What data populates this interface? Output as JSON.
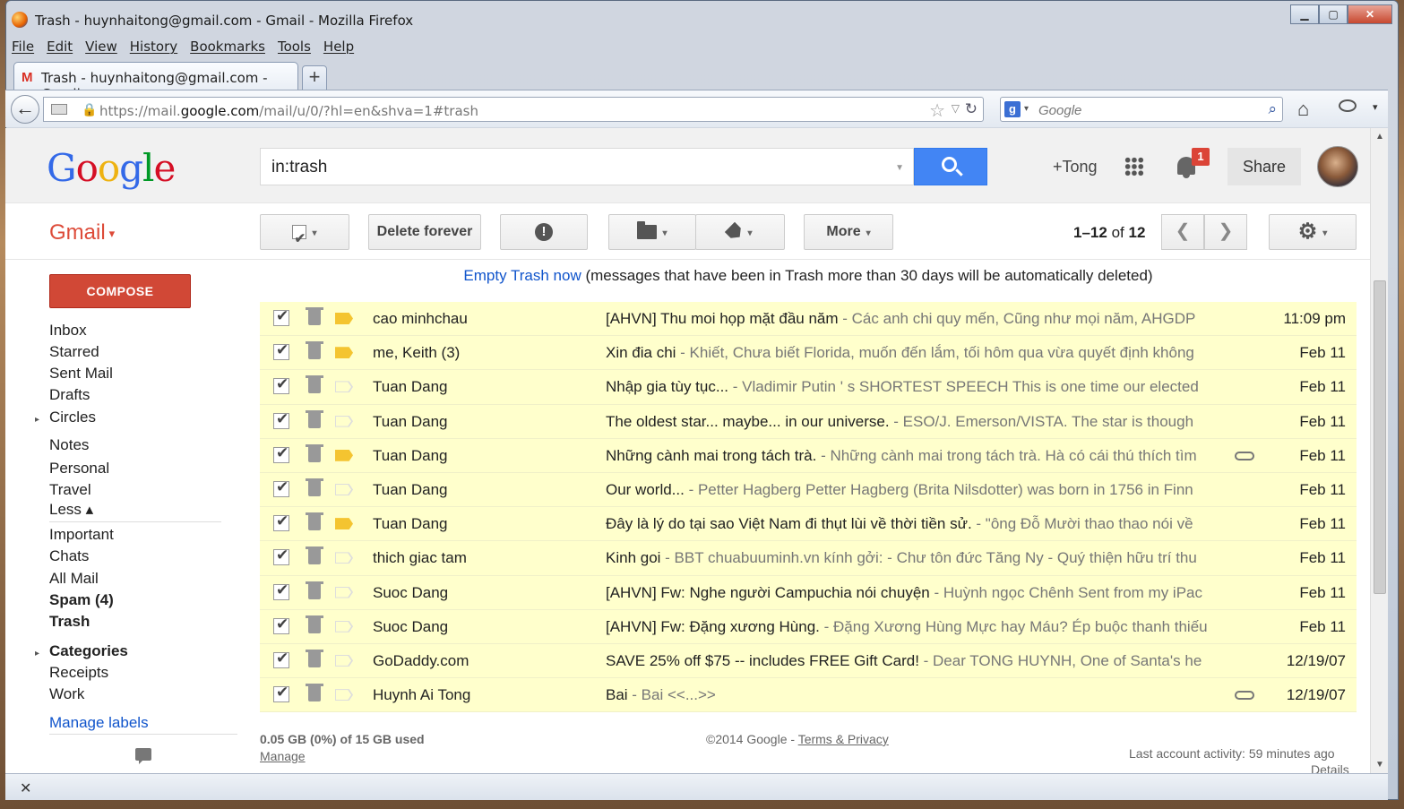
{
  "window": {
    "title": "Trash - huynhaitong@gmail.com - Gmail - Mozilla Firefox",
    "controls": {
      "minimize": "▁",
      "maximize": "▢",
      "close": "✕"
    }
  },
  "menu": [
    "File",
    "Edit",
    "View",
    "History",
    "Bookmarks",
    "Tools",
    "Help"
  ],
  "tab": {
    "icon": "M",
    "label": "Trash - huynhaitong@gmail.com - Gmail",
    "new_tab": "+"
  },
  "nav": {
    "back": "←",
    "url_prefix": "https://mail.",
    "url_domain": "google.com",
    "url_suffix": "/mail/u/0/?hl=en&shva=1#trash",
    "search_engine_icon": "g",
    "search_placeholder": "Google",
    "star": "☆",
    "dropdown": "▽",
    "reload": "↻",
    "search_go": "⌕",
    "home": "⌂"
  },
  "gmail_header": {
    "logo": [
      "G",
      "o",
      "o",
      "g",
      "l",
      "e"
    ],
    "search_value": "in:trash",
    "plus_name": "+Tong",
    "notification_count": "1",
    "share_label": "Share"
  },
  "toolbar": {
    "gmail_label": "Gmail",
    "delete_forever": "Delete forever",
    "spam_glyph": "!",
    "more": "More",
    "pager_range": "1–12",
    "pager_of": "of",
    "pager_total": "12",
    "prev": "❮",
    "next": "❯",
    "gear": "⚙",
    "caret": "▾"
  },
  "sidebar": {
    "compose": "COMPOSE",
    "items": [
      {
        "label": "Inbox",
        "bold": false
      },
      {
        "label": "Starred",
        "bold": false
      },
      {
        "label": "Sent Mail",
        "bold": false
      },
      {
        "label": "Drafts",
        "bold": false
      },
      {
        "label": "Circles",
        "bold": false
      },
      {
        "label": "Notes",
        "bold": false
      },
      {
        "label": "Personal",
        "bold": false
      },
      {
        "label": "Travel",
        "bold": false
      },
      {
        "label": "Less ▴",
        "bold": false
      },
      {
        "label": "Important",
        "bold": false
      },
      {
        "label": "Chats",
        "bold": false
      },
      {
        "label": "All Mail",
        "bold": false
      },
      {
        "label": "Spam (4)",
        "bold": true
      },
      {
        "label": "Trash",
        "bold": true
      },
      {
        "label": "Categories",
        "bold": true
      },
      {
        "label": "Receipts",
        "bold": false
      },
      {
        "label": "Work",
        "bold": false
      }
    ],
    "expand_arrow": "▸",
    "manage_labels": "Manage labels"
  },
  "notice": {
    "link": "Empty Trash now",
    "text": " (messages that have been in Trash more than 30 days will be automatically deleted)"
  },
  "messages": [
    {
      "sender": "cao minhchau",
      "subject": "[AHVN] Thu moi họp mặt đầu năm",
      "snippet": " - Các anh chi quy mến, Cũng như mọi năm, AHGDP",
      "date": "11:09 pm",
      "important": true,
      "attachment": false
    },
    {
      "sender": "me, Keith (3)",
      "subject": "Xin đia chi",
      "snippet": " - Khiết, Chưa biết Florida, muốn đến lắm, tối hôm qua vừa quyết định không",
      "date": "Feb 11",
      "important": true,
      "attachment": false
    },
    {
      "sender": "Tuan Dang",
      "subject": "Nhập gia tùy tục...",
      "snippet": " - Vladimir Putin ' s SHORTEST SPEECH This is one time our elected",
      "date": "Feb 11",
      "important": false,
      "attachment": false
    },
    {
      "sender": "Tuan Dang",
      "subject": "The oldest star... maybe... in our universe.",
      "snippet": " - ESO/J. Emerson/VISTA. The star is though",
      "date": "Feb 11",
      "important": false,
      "attachment": false
    },
    {
      "sender": "Tuan Dang",
      "subject": "Những cành mai trong tách trà.",
      "snippet": " - Những cành mai trong tách trà. Hà có cái thú thích tìm",
      "date": "Feb 11",
      "important": true,
      "attachment": true
    },
    {
      "sender": "Tuan Dang",
      "subject": "Our world...",
      "snippet": " - Petter Hagberg Petter Hagberg (Brita Nilsdotter) was born in 1756 in Finn",
      "date": "Feb 11",
      "important": false,
      "attachment": false
    },
    {
      "sender": "Tuan Dang",
      "subject": "Đây là lý do tại sao Việt Nam đi thụt lùi về thời tiền sử.",
      "snippet": " - \"ông Đỗ Mười thao thao nói về",
      "date": "Feb 11",
      "important": true,
      "attachment": false
    },
    {
      "sender": "thich giac tam",
      "subject": "Kinh goi",
      "snippet": " - BBT chuabuuminh.vn kính gởi: - Chư tôn đức Tăng Ny - Quý thiện hữu trí thu",
      "date": "Feb 11",
      "important": false,
      "attachment": false
    },
    {
      "sender": "Suoc Dang",
      "subject": "[AHVN] Fw: Nghe người Campuchia nói chuyện",
      "snippet": " - Huỳnh ngọc Chênh Sent from my iPac",
      "date": "Feb 11",
      "important": false,
      "attachment": false
    },
    {
      "sender": "Suoc Dang",
      "subject": "[AHVN] Fw: Đặng xương Hùng.",
      "snippet": " - Đặng Xương Hùng Mực hay Máu? Ép buộc thanh thiếu",
      "date": "Feb 11",
      "important": false,
      "attachment": false
    },
    {
      "sender": "GoDaddy.com",
      "subject": "SAVE 25% off $75 -- includes FREE Gift Card!",
      "snippet": " - Dear TONG HUYNH, One of Santa's he",
      "date": "12/19/07",
      "important": false,
      "attachment": false
    },
    {
      "sender": "Huynh Ai Tong",
      "subject": "Bai",
      "snippet": " - Bai <<...>>",
      "date": "12/19/07",
      "important": false,
      "attachment": true
    }
  ],
  "footer": {
    "storage": "0.05 GB (0%) of 15 GB used",
    "manage": "Manage",
    "copyright": "©2014 Google - ",
    "terms": "Terms & Privacy",
    "last_activity": "Last account activity: 59 minutes ago",
    "details": "Details"
  },
  "statusbar": {
    "close": "✕"
  },
  "colors": {
    "gmail_red": "#dd4b39",
    "compose_red": "#d14836",
    "search_blue": "#4285f4",
    "row_yellow": "#ffffcc",
    "important": "#f4c430",
    "link_blue": "#1155cc"
  }
}
